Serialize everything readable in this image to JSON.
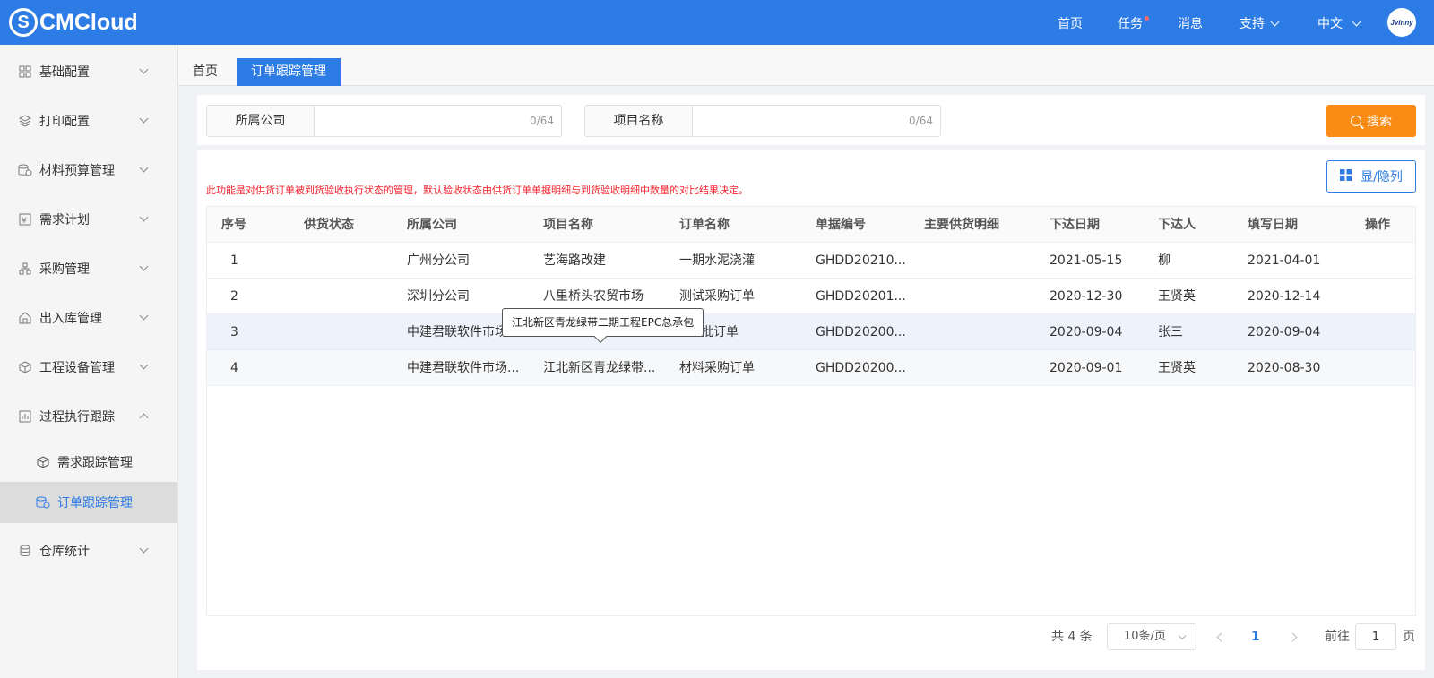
{
  "app": {
    "logo_text": "CMCloud",
    "logo_mark": "S"
  },
  "topnav": {
    "items": [
      "首页",
      "任务",
      "消息",
      "支持",
      "中文"
    ],
    "avatar_text": "Jvinny"
  },
  "sidebar": {
    "items": [
      {
        "label": "基础配置",
        "icon": "grid-icon"
      },
      {
        "label": "打印配置",
        "icon": "layers-icon"
      },
      {
        "label": "材料预算管理",
        "icon": "coins-icon"
      },
      {
        "label": "需求计划",
        "icon": "money-doc-icon"
      },
      {
        "label": "采购管理",
        "icon": "hierarchy-icon"
      },
      {
        "label": "出入库管理",
        "icon": "warehouse-icon"
      },
      {
        "label": "工程设备管理",
        "icon": "cube-icon"
      },
      {
        "label": "过程执行跟踪",
        "icon": "chart-doc-icon"
      },
      {
        "label": "仓库统计",
        "icon": "database-icon"
      }
    ],
    "sub_items": [
      {
        "label": "需求跟踪管理",
        "icon": "cube-icon"
      },
      {
        "label": "订单跟踪管理",
        "icon": "coins-check-icon",
        "active": true
      }
    ]
  },
  "tabs": [
    {
      "label": "首页",
      "active": false
    },
    {
      "label": "订单跟踪管理",
      "active": true
    }
  ],
  "search": {
    "company_label": "所属公司",
    "company_value": "",
    "company_count": "0/64",
    "project_label": "项目名称",
    "project_value": "",
    "project_count": "0/64",
    "search_button": "搜索",
    "toggle_columns_button": "显/隐列"
  },
  "notice": "此功能是对供货订单被到货验收执行状态的管理，默认验收状态由供货订单单据明细与到货验收明细中数量的对比结果决定。",
  "table": {
    "columns": [
      "序号",
      "供货状态",
      "所属公司",
      "项目名称",
      "订单名称",
      "单据编号",
      "主要供货明细",
      "下达日期",
      "下达人",
      "填写日期",
      "操作"
    ],
    "rows": [
      [
        "1",
        "",
        "广州分公司",
        "艺海路改建",
        "一期水泥浇灌",
        "GHDD20210...",
        "",
        "2021-05-15",
        "柳",
        "2021-04-01",
        ""
      ],
      [
        "2",
        "",
        "深圳分公司",
        "八里桥头农贸市场",
        "测试采购订单",
        "GHDD20201...",
        "",
        "2020-12-30",
        "王贤英",
        "2020-12-14",
        ""
      ],
      [
        "3",
        "",
        "中建君联软件市场...",
        "",
        "批订单",
        "GHDD20200...",
        "",
        "2020-09-04",
        "张三",
        "2020-09-04",
        ""
      ],
      [
        "4",
        "",
        "中建君联软件市场...",
        "江北新区青龙绿带...",
        "材料采购订单",
        "GHDD20200...",
        "",
        "2020-09-01",
        "王贤英",
        "2020-08-30",
        ""
      ]
    ]
  },
  "tooltip": "江北新区青龙绿带二期工程EPC总承包",
  "pagination": {
    "total": "共 4 条",
    "page_size": "10条/页",
    "current_page": "1",
    "goto_label": "前往",
    "goto_value": "1",
    "page_suffix": "页"
  },
  "colors": {
    "primary": "#2d7be5",
    "search_button": "#fa8c16",
    "notice": "#f5222d"
  }
}
